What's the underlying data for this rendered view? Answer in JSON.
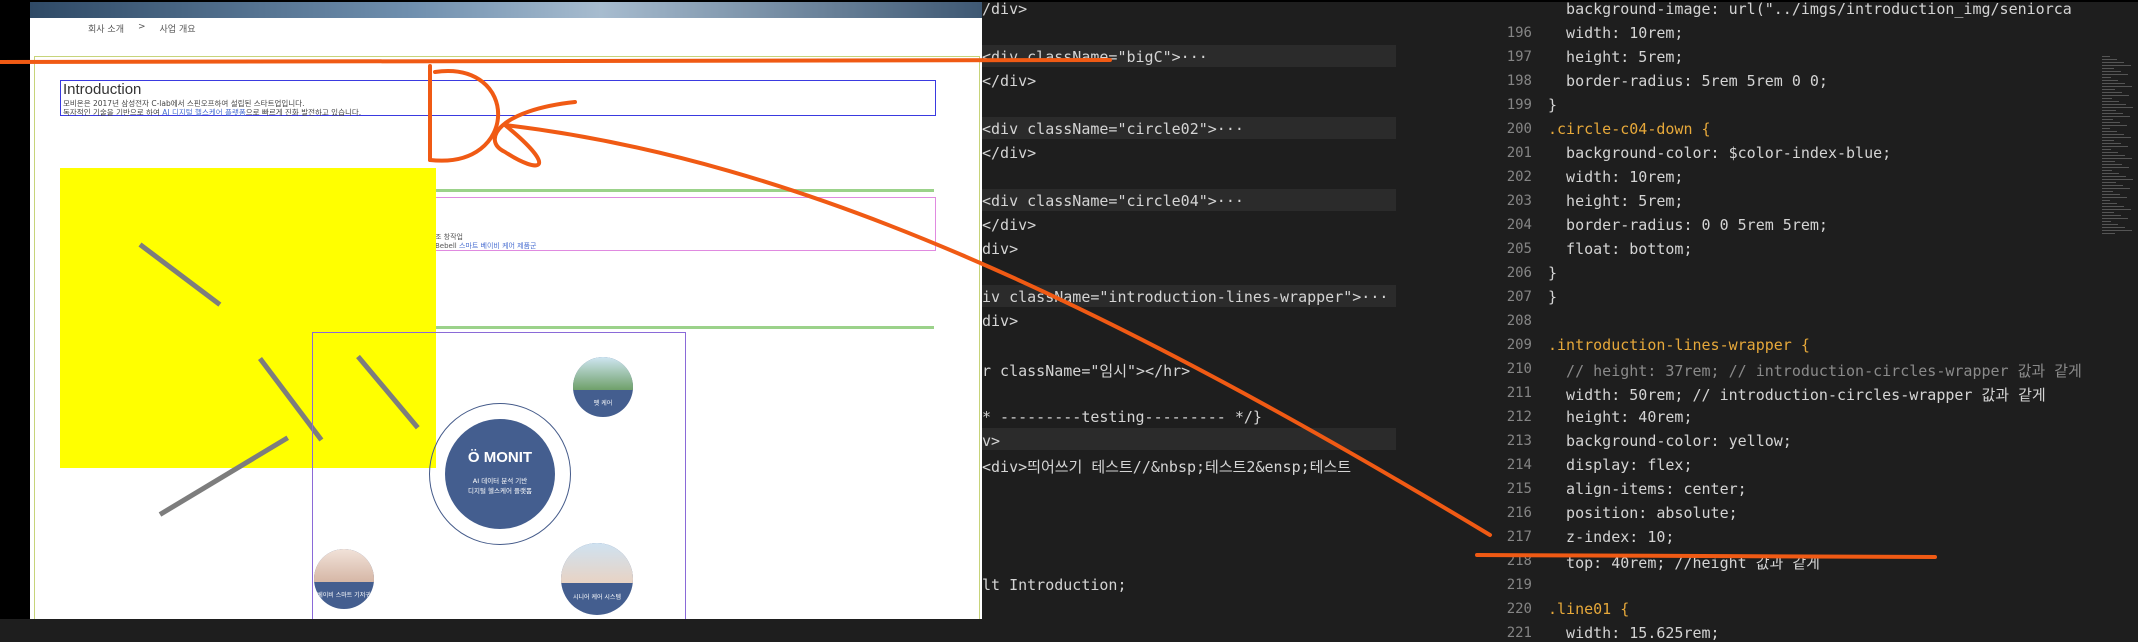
{
  "browser": {
    "breadcrumb": [
      "회사 소개",
      ">",
      "사업 개요"
    ],
    "intro": {
      "title": "Introduction",
      "line1": "모비온은 2017년 삼성전자 C-lab에서 스핀오프하여 설립된 스타트업입니다.",
      "line2a": "독자적인 기술을 기반으로 하여 ",
      "line2b": "AI 디지털 헬스케어 플랫폼",
      "line2c": "으로 빠르게 진화 발전하고 있습니다."
    },
    "pink": {
      "line1": "조 창작업",
      "line2a": "Bebell",
      "line2b": " 스마트 베이비 케어 제품군"
    },
    "monit": {
      "logo": "MONIT",
      "sub1": "AI 데이터 분석 기반",
      "sub2": "디지털 헬스케어 플랫폼"
    },
    "circles": [
      {
        "label": "펫 케어"
      },
      {
        "label": "베이비 스마트 기저귀"
      },
      {
        "label": "시니어 케어 시스템"
      }
    ]
  },
  "editor_left": {
    "lines": [
      {
        "t": "/div>"
      },
      {
        "t": ""
      },
      {
        "t": "<div className=\"bigC\">···"
      },
      {
        "t": "</div>"
      },
      {
        "t": ""
      },
      {
        "t": "<div className=\"circle02\">···"
      },
      {
        "t": "</div>"
      },
      {
        "t": ""
      },
      {
        "t": "<div className=\"circle04\">···"
      },
      {
        "t": "</div>"
      },
      {
        "t": "div>"
      },
      {
        "t": ""
      },
      {
        "t": "iv className=\"introduction-lines-wrapper\">···"
      },
      {
        "t": "div>"
      },
      {
        "t": ""
      },
      {
        "t": "r className=\"임시\"></hr>"
      },
      {
        "t": ""
      },
      {
        "t": "* ---------testing--------- */}"
      },
      {
        "t": "v>"
      },
      {
        "t": "<div>띄어쓰기 테스트//&nbsp;테스트2&ensp;테스트"
      },
      {
        "t": ""
      },
      {
        "t": ""
      },
      {
        "t": ""
      },
      {
        "t": ""
      },
      {
        "t": "lt Introduction;"
      }
    ]
  },
  "editor_right": {
    "lines": [
      {
        "n": "",
        "t": "  background-image: url(\"../imgs/introduction_img/seniorca"
      },
      {
        "n": "196",
        "t": "  width: 10rem;"
      },
      {
        "n": "197",
        "t": "  height: 5rem;"
      },
      {
        "n": "198",
        "t": "  border-radius: 5rem 5rem 0 0;"
      },
      {
        "n": "199",
        "t": "}"
      },
      {
        "n": "200",
        "t": ".circle-c04-down {"
      },
      {
        "n": "201",
        "t": "  background-color: $color-index-blue;"
      },
      {
        "n": "202",
        "t": "  width: 10rem;"
      },
      {
        "n": "203",
        "t": "  height: 5rem;"
      },
      {
        "n": "204",
        "t": "  border-radius: 0 0 5rem 5rem;"
      },
      {
        "n": "205",
        "t": "  float: bottom;"
      },
      {
        "n": "206",
        "t": "}"
      },
      {
        "n": "207",
        "t": "}"
      },
      {
        "n": "208",
        "t": ""
      },
      {
        "n": "209",
        "t": ".introduction-lines-wrapper {"
      },
      {
        "n": "210",
        "t": "  // height: 37rem; // introduction-circles-wrapper 값과 같게"
      },
      {
        "n": "211",
        "t": "  width: 50rem; // introduction-circles-wrapper 값과 같게"
      },
      {
        "n": "212",
        "t": "  height: 40rem;"
      },
      {
        "n": "213",
        "t": "  background-color: yellow;"
      },
      {
        "n": "214",
        "t": "  display: flex;"
      },
      {
        "n": "215",
        "t": "  align-items: center;"
      },
      {
        "n": "216",
        "t": "  position: absolute;"
      },
      {
        "n": "217",
        "t": "  z-index: 10;"
      },
      {
        "n": "218",
        "t": "  top: 40rem; //height 값과 같게"
      },
      {
        "n": "219",
        "t": ""
      },
      {
        "n": "220",
        "t": ".line01 {"
      },
      {
        "n": "221",
        "t": "  width: 15.625rem;"
      }
    ]
  }
}
